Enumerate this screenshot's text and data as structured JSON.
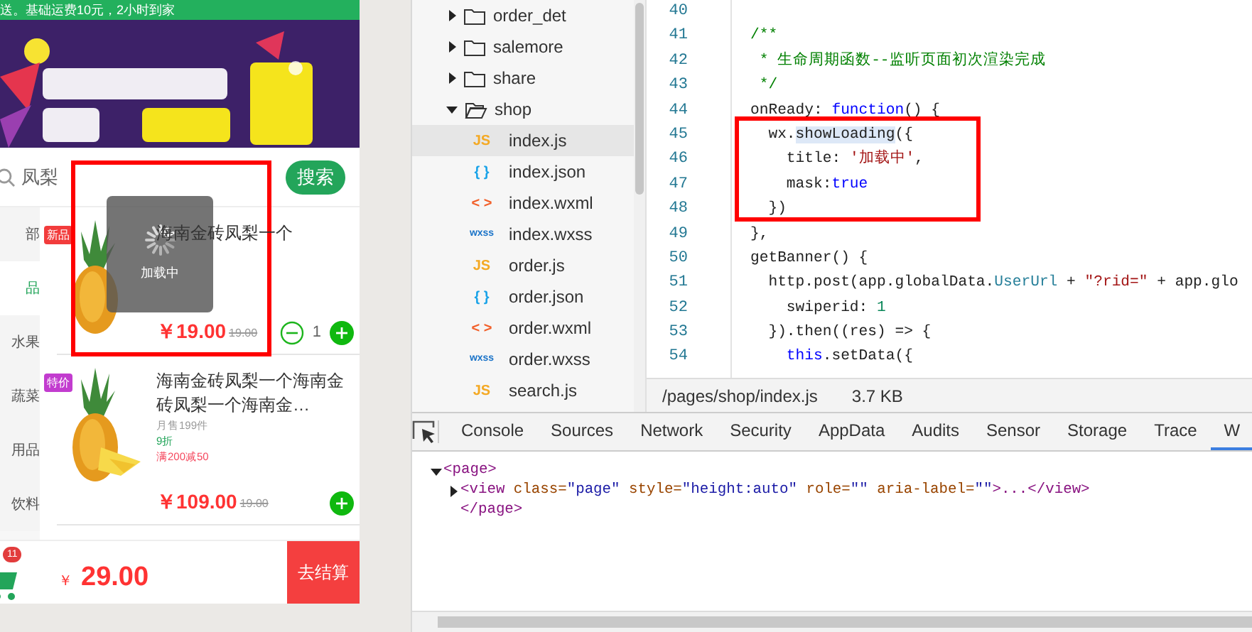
{
  "simulator": {
    "notice": "送。基础运费10元，2小时到家",
    "search": {
      "value": "凤梨",
      "button": "搜索"
    },
    "categories": [
      {
        "label": "部",
        "selected": false
      },
      {
        "label": "品",
        "selected": true
      },
      {
        "label": "水果",
        "selected": false
      },
      {
        "label": "蔬菜",
        "selected": false
      },
      {
        "label": "用品",
        "selected": false
      },
      {
        "label": "饮料",
        "selected": false
      }
    ],
    "products": [
      {
        "tag": "新品",
        "color": "#f23c3c",
        "title": "海南金砖凤梨一个",
        "price": "￥19.00",
        "original_price": "19.00",
        "quantity": "1"
      },
      {
        "tag": "特价",
        "color": "#c23ccf",
        "title": "海南金砖凤梨一个海南金砖凤梨一个海南金…",
        "meta": [
          {
            "kind": "sales",
            "text": "月售199件"
          },
          {
            "kind": "discount",
            "text": "9折"
          },
          {
            "kind": "promo",
            "text": "满200减50"
          }
        ],
        "price": "￥109.00",
        "original_price": "19.00"
      }
    ],
    "cart": {
      "badge": "11",
      "currency": "￥",
      "total": "29.00",
      "checkout": "去结算"
    },
    "loading": {
      "text": "加载中"
    }
  },
  "file_tree": [
    {
      "name": "order_det",
      "kind": "folder",
      "expanded": false
    },
    {
      "name": "salemore",
      "kind": "folder",
      "expanded": false
    },
    {
      "name": "share",
      "kind": "folder",
      "expanded": false
    },
    {
      "name": "shop",
      "kind": "folder",
      "expanded": true,
      "children": [
        {
          "name": "index.js",
          "kind": "js",
          "icon": "JS",
          "selected": true
        },
        {
          "name": "index.json",
          "kind": "json",
          "icon": "{ }",
          "selected": false
        },
        {
          "name": "index.wxml",
          "kind": "wxml",
          "icon": "< >",
          "selected": false
        },
        {
          "name": "index.wxss",
          "kind": "wxss",
          "icon": "wxss",
          "selected": false
        },
        {
          "name": "order.js",
          "kind": "js",
          "icon": "JS",
          "selected": false
        },
        {
          "name": "order.json",
          "kind": "json",
          "icon": "{ }",
          "selected": false
        },
        {
          "name": "order.wxml",
          "kind": "wxml",
          "icon": "< >",
          "selected": false
        },
        {
          "name": "order.wxss",
          "kind": "wxss",
          "icon": "wxss",
          "selected": false
        },
        {
          "name": "search.js",
          "kind": "js",
          "icon": "JS",
          "selected": false
        }
      ]
    }
  ],
  "editor": {
    "lines": [
      {
        "number": "40"
      },
      {
        "number": "41",
        "tokens": [
          {
            "kind": "comment",
            "text": "/**"
          }
        ]
      },
      {
        "number": "42",
        "tokens": [
          {
            "kind": "comment",
            "text": " * 生命周期函数--监听页面初次渲染完成"
          }
        ]
      },
      {
        "number": "43",
        "tokens": [
          {
            "kind": "comment",
            "text": " */"
          }
        ]
      },
      {
        "number": "44",
        "tokens": [
          {
            "kind": "plain",
            "text": "onReady: "
          },
          {
            "kind": "keyword",
            "text": "function"
          },
          {
            "kind": "plain",
            "text": "() {"
          }
        ]
      },
      {
        "number": "45",
        "tokens": [
          {
            "kind": "plain",
            "text": "  wx."
          },
          {
            "kind": "match",
            "text": "showLoading"
          },
          {
            "kind": "plain",
            "text": "({"
          }
        ]
      },
      {
        "number": "46",
        "tokens": [
          {
            "kind": "plain",
            "text": "    title: "
          },
          {
            "kind": "string",
            "text": "'加载中'"
          },
          {
            "kind": "plain",
            "text": ","
          }
        ]
      },
      {
        "number": "47",
        "tokens": [
          {
            "kind": "plain",
            "text": "    mask:"
          },
          {
            "kind": "keyword",
            "text": "true"
          }
        ]
      },
      {
        "number": "48",
        "tokens": [
          {
            "kind": "plain",
            "text": "  })"
          }
        ]
      },
      {
        "number": "49",
        "tokens": [
          {
            "kind": "plain",
            "text": "},"
          }
        ]
      },
      {
        "number": "50",
        "tokens": [
          {
            "kind": "plain",
            "text": "getBanner() {"
          }
        ]
      },
      {
        "number": "51",
        "tokens": [
          {
            "kind": "plain",
            "text": "  http.post(app.globalData."
          },
          {
            "kind": "property",
            "text": "UserUrl"
          },
          {
            "kind": "plain",
            "text": " + "
          },
          {
            "kind": "string",
            "text": "\"?rid=\""
          },
          {
            "kind": "plain",
            "text": " + app.glo"
          }
        ]
      },
      {
        "number": "52",
        "tokens": [
          {
            "kind": "plain",
            "text": "    swiperid: "
          },
          {
            "kind": "number",
            "text": "1"
          }
        ]
      },
      {
        "number": "53",
        "tokens": [
          {
            "kind": "plain",
            "text": "  }).then((res) => {"
          }
        ]
      },
      {
        "number": "54",
        "tokens": [
          {
            "kind": "keyword",
            "text": "    this"
          },
          {
            "kind": "plain",
            "text": ".setData({"
          }
        ]
      }
    ],
    "status": {
      "path": "/pages/shop/index.js",
      "size": "3.7 KB"
    }
  },
  "devtools": {
    "tabs": [
      {
        "label": "Console",
        "selected": false
      },
      {
        "label": "Sources",
        "selected": false
      },
      {
        "label": "Network",
        "selected": false
      },
      {
        "label": "Security",
        "selected": false
      },
      {
        "label": "AppData",
        "selected": false
      },
      {
        "label": "Audits",
        "selected": false
      },
      {
        "label": "Sensor",
        "selected": false
      },
      {
        "label": "Storage",
        "selected": false
      },
      {
        "label": "Trace",
        "selected": false
      },
      {
        "label": "W",
        "selected": true
      }
    ],
    "elements": [
      {
        "expanded": true,
        "tokens": [
          {
            "kind": "tag",
            "text": "<page>"
          }
        ],
        "children": [
          {
            "expanded": false,
            "tokens": [
              {
                "kind": "tag",
                "text": "<view"
              },
              {
                "kind": "attr",
                "text": " class="
              },
              {
                "kind": "value",
                "text": "\"page\""
              },
              {
                "kind": "attr",
                "text": " style="
              },
              {
                "kind": "value",
                "text": "\"height:auto\""
              },
              {
                "kind": "attr",
                "text": " role="
              },
              {
                "kind": "value",
                "text": "\"\""
              },
              {
                "kind": "attr",
                "text": " aria-label="
              },
              {
                "kind": "value",
                "text": "\"\""
              },
              {
                "kind": "tag",
                "text": ">...</view>"
              }
            ]
          }
        ],
        "closing": [
          {
            "kind": "tag",
            "text": "</page>"
          }
        ]
      }
    ]
  }
}
